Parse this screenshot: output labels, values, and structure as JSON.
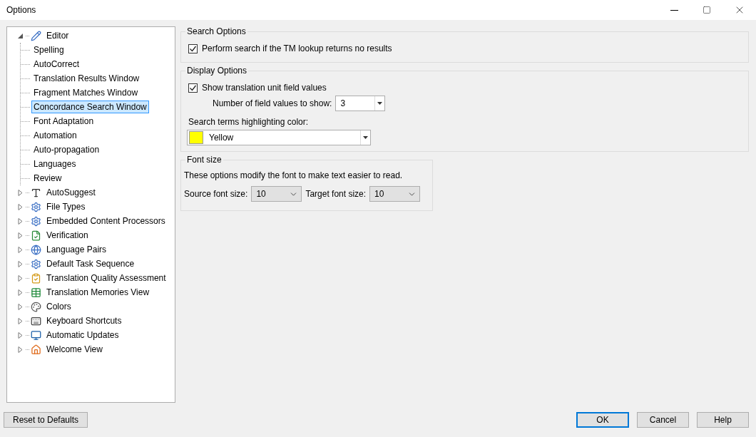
{
  "window": {
    "title": "Options"
  },
  "tree": [
    {
      "label": "Editor",
      "expanded": true,
      "selected": false,
      "children": [
        {
          "label": "Spelling",
          "selected": false
        },
        {
          "label": "AutoCorrect",
          "selected": false
        },
        {
          "label": "Translation Results Window",
          "selected": false
        },
        {
          "label": "Fragment Matches Window",
          "selected": false
        },
        {
          "label": "Concordance Search Window",
          "selected": true
        },
        {
          "label": "Font Adaptation",
          "selected": false
        },
        {
          "label": "Automation",
          "selected": false
        },
        {
          "label": "Auto-propagation",
          "selected": false
        },
        {
          "label": "Languages",
          "selected": false
        },
        {
          "label": "Review",
          "selected": false
        }
      ]
    },
    {
      "label": "AutoSuggest",
      "expanded": false,
      "selected": false
    },
    {
      "label": "File Types",
      "expanded": false,
      "selected": false
    },
    {
      "label": "Embedded Content Processors",
      "expanded": false,
      "selected": false
    },
    {
      "label": "Verification",
      "expanded": false,
      "selected": false
    },
    {
      "label": "Language Pairs",
      "expanded": false,
      "selected": false
    },
    {
      "label": "Default Task Sequence",
      "expanded": false,
      "selected": false
    },
    {
      "label": "Translation Quality Assessment",
      "expanded": false,
      "selected": false
    },
    {
      "label": "Translation Memories View",
      "expanded": false,
      "selected": false
    },
    {
      "label": "Colors",
      "expanded": false,
      "selected": false
    },
    {
      "label": "Keyboard Shortcuts",
      "expanded": false,
      "selected": false
    },
    {
      "label": "Automatic Updates",
      "expanded": false,
      "selected": false
    },
    {
      "label": "Welcome View",
      "expanded": false,
      "selected": false
    }
  ],
  "search_options": {
    "title": "Search Options",
    "perform_search": {
      "label": "Perform search if the TM lookup returns no results",
      "checked": true
    }
  },
  "display_options": {
    "title": "Display Options",
    "show_field_values": {
      "label": "Show translation unit field values",
      "checked": true
    },
    "field_count": {
      "label": "Number of field values to show:",
      "value": "3"
    },
    "highlight_color": {
      "label": "Search terms highlighting color:",
      "value": "Yellow",
      "color": "#ffff00"
    }
  },
  "font_size": {
    "title": "Font size",
    "description": "These options modify the font to make text easier to read.",
    "source": {
      "label": "Source font size:",
      "value": "10"
    },
    "target": {
      "label": "Target font size:",
      "value": "10"
    }
  },
  "buttons": {
    "reset": "Reset to Defaults",
    "ok": "OK",
    "cancel": "Cancel",
    "help": "Help"
  }
}
